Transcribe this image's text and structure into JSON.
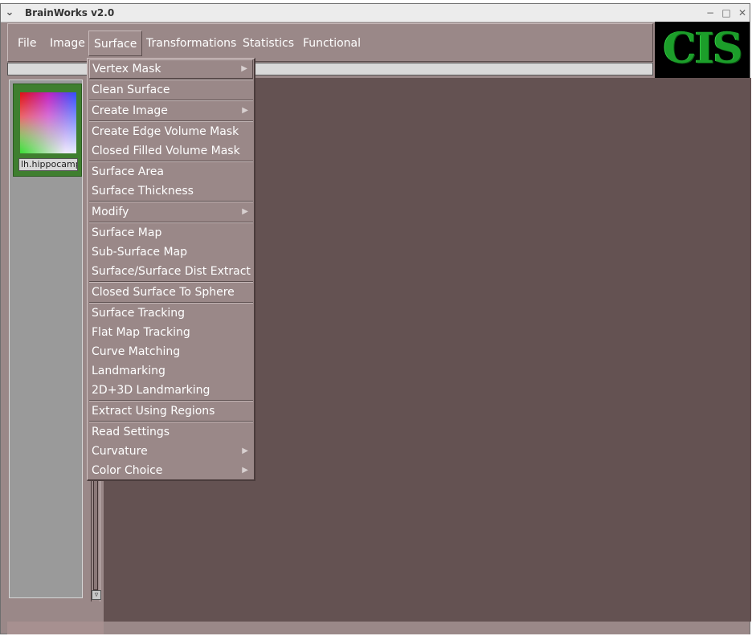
{
  "window": {
    "title": "BrainWorks v2.0",
    "controls": {
      "minimize": "−",
      "maximize": "□",
      "close": "✕"
    }
  },
  "menubar": {
    "items": [
      {
        "label": "File"
      },
      {
        "label": "Image"
      },
      {
        "label": "Surface"
      },
      {
        "label": "Transformations"
      },
      {
        "label": "Statistics"
      },
      {
        "label": "Functional"
      }
    ],
    "active": "Surface"
  },
  "logo": {
    "text": "CIS"
  },
  "thumbnail": {
    "label": "lh.hippocamp"
  },
  "dropdown": {
    "items": [
      {
        "label": "Vertex Mask",
        "submenu": true
      },
      {
        "label": "Clean Surface",
        "submenu": false
      },
      {
        "label": "Create Image",
        "submenu": true
      },
      {
        "label": "Create Edge Volume Mask",
        "submenu": false
      },
      {
        "label": "Closed Filled Volume Mask",
        "submenu": false
      },
      {
        "label": "Surface Area",
        "submenu": false
      },
      {
        "label": "Surface Thickness",
        "submenu": false
      },
      {
        "label": "Modify",
        "submenu": true
      },
      {
        "label": "Surface Map",
        "submenu": false
      },
      {
        "label": "Sub-Surface Map",
        "submenu": false
      },
      {
        "label": "Surface/Surface Dist Extract",
        "submenu": false
      },
      {
        "label": "Closed Surface To Sphere",
        "submenu": false
      },
      {
        "label": "Surface Tracking",
        "submenu": false
      },
      {
        "label": "Flat Map Tracking",
        "submenu": false
      },
      {
        "label": "Curve Matching",
        "submenu": false
      },
      {
        "label": "Landmarking",
        "submenu": false
      },
      {
        "label": "2D+3D Landmarking",
        "submenu": false
      },
      {
        "label": "Extract Using Regions",
        "submenu": false
      },
      {
        "label": "Read Settings",
        "submenu": false
      },
      {
        "label": "Curvature",
        "submenu": true
      },
      {
        "label": "Color Choice",
        "submenu": true
      }
    ],
    "submenu_arrow": "▶"
  },
  "colors": {
    "menu_bg": "#9a8888",
    "canvas_bg": "#645252",
    "logo_green": "#1c9e2a"
  }
}
